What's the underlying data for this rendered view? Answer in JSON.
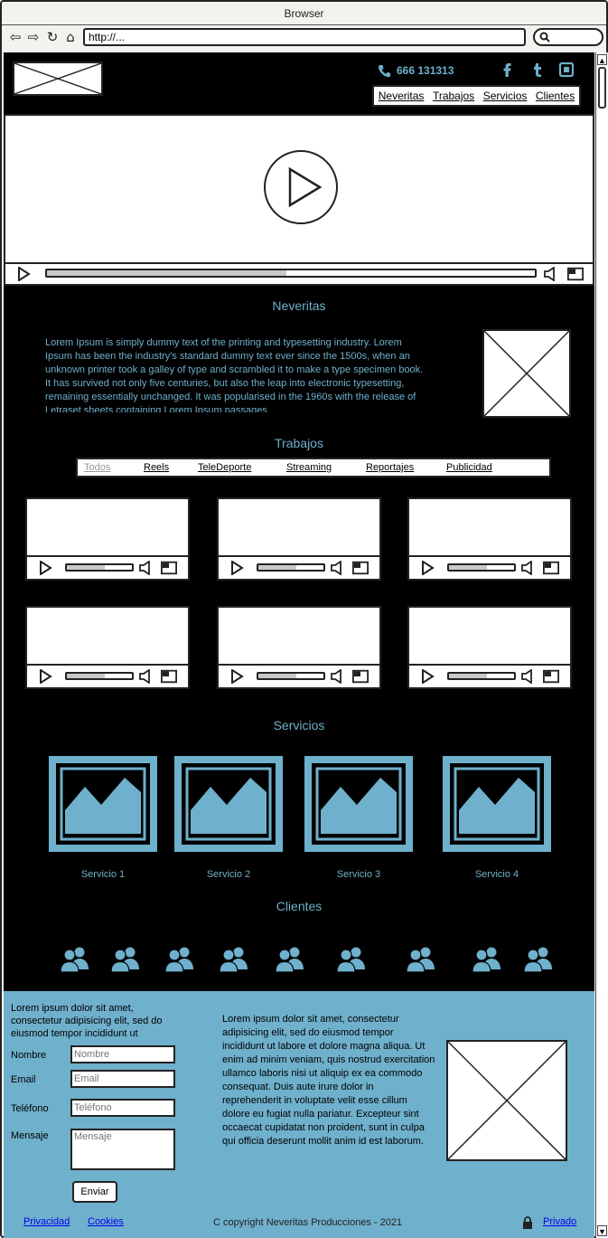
{
  "browser": {
    "title": "Browser",
    "url": "http://..."
  },
  "header": {
    "phone": "666 131313",
    "nav": [
      "Neveritas",
      "Trabajos",
      "Servicios",
      "Clientes"
    ]
  },
  "hero": {
    "progress": 0.49
  },
  "about": {
    "title": "Neveritas",
    "text": "Lorem Ipsum is simply dummy text of the printing and typesetting industry. Lorem Ipsum has been the industry's standard dummy text ever since the 1500s, when an unknown printer took a galley of type and scrambled it to make a type specimen book. It has survived not only five centuries, but also the leap into electronic typesetting, remaining essentially unchanged. It was popularised in the 1960s with the release of Letraset sheets containing Lorem Ipsum passages"
  },
  "works": {
    "title": "Trabajos",
    "filters": [
      "Todos",
      "Reels",
      "TeleDeporte",
      "Streaming",
      "Reportajes",
      "Publicidad"
    ],
    "active_filter": "Todos",
    "video_progress": [
      0.58,
      0.58,
      0.58,
      0.58,
      0.58,
      0.58
    ]
  },
  "services": {
    "title": "Servicios",
    "items": [
      "Servicio 1",
      "Servicio 2",
      "Servicio 3",
      "Servicio 4"
    ]
  },
  "clients": {
    "title": "Clientes",
    "count": 9
  },
  "contact": {
    "intro": "Lorem ipsum dolor sit amet, consectetur adipisicing elit, sed do eiusmod tempor incididunt ut",
    "labels": {
      "name": "Nombre",
      "email": "Email",
      "phone": "Teléfono",
      "message": "Mensaje"
    },
    "placeholders": {
      "name": "Nombre",
      "email": "Email",
      "phone": "Teléfono",
      "message": "Mensaje"
    },
    "submit": "Enviar",
    "body": "Lorem ipsum dolor sit amet, consectetur adipisicing elit, sed do eiusmod tempor incididunt ut labore et dolore magna aliqua. Ut enim ad minim veniam, quis nostrud exercitation ullamco laboris nisi ut aliquip ex ea commodo consequat. Duis aute irure dolor in reprehenderit in voluptate velit esse cillum dolore eu fugiat nulla pariatur. Excepteur sint occaecat cupidatat non proident, sunt in culpa qui officia deserunt mollit anim id est laborum."
  },
  "footer": {
    "privacy": "Privacidad",
    "cookies": "Cookies",
    "copyright": "C copyright Neveritas Producciones - 2021",
    "private": "Privado"
  },
  "colors": {
    "accent": "#6fb0cc",
    "background": "#000000"
  }
}
